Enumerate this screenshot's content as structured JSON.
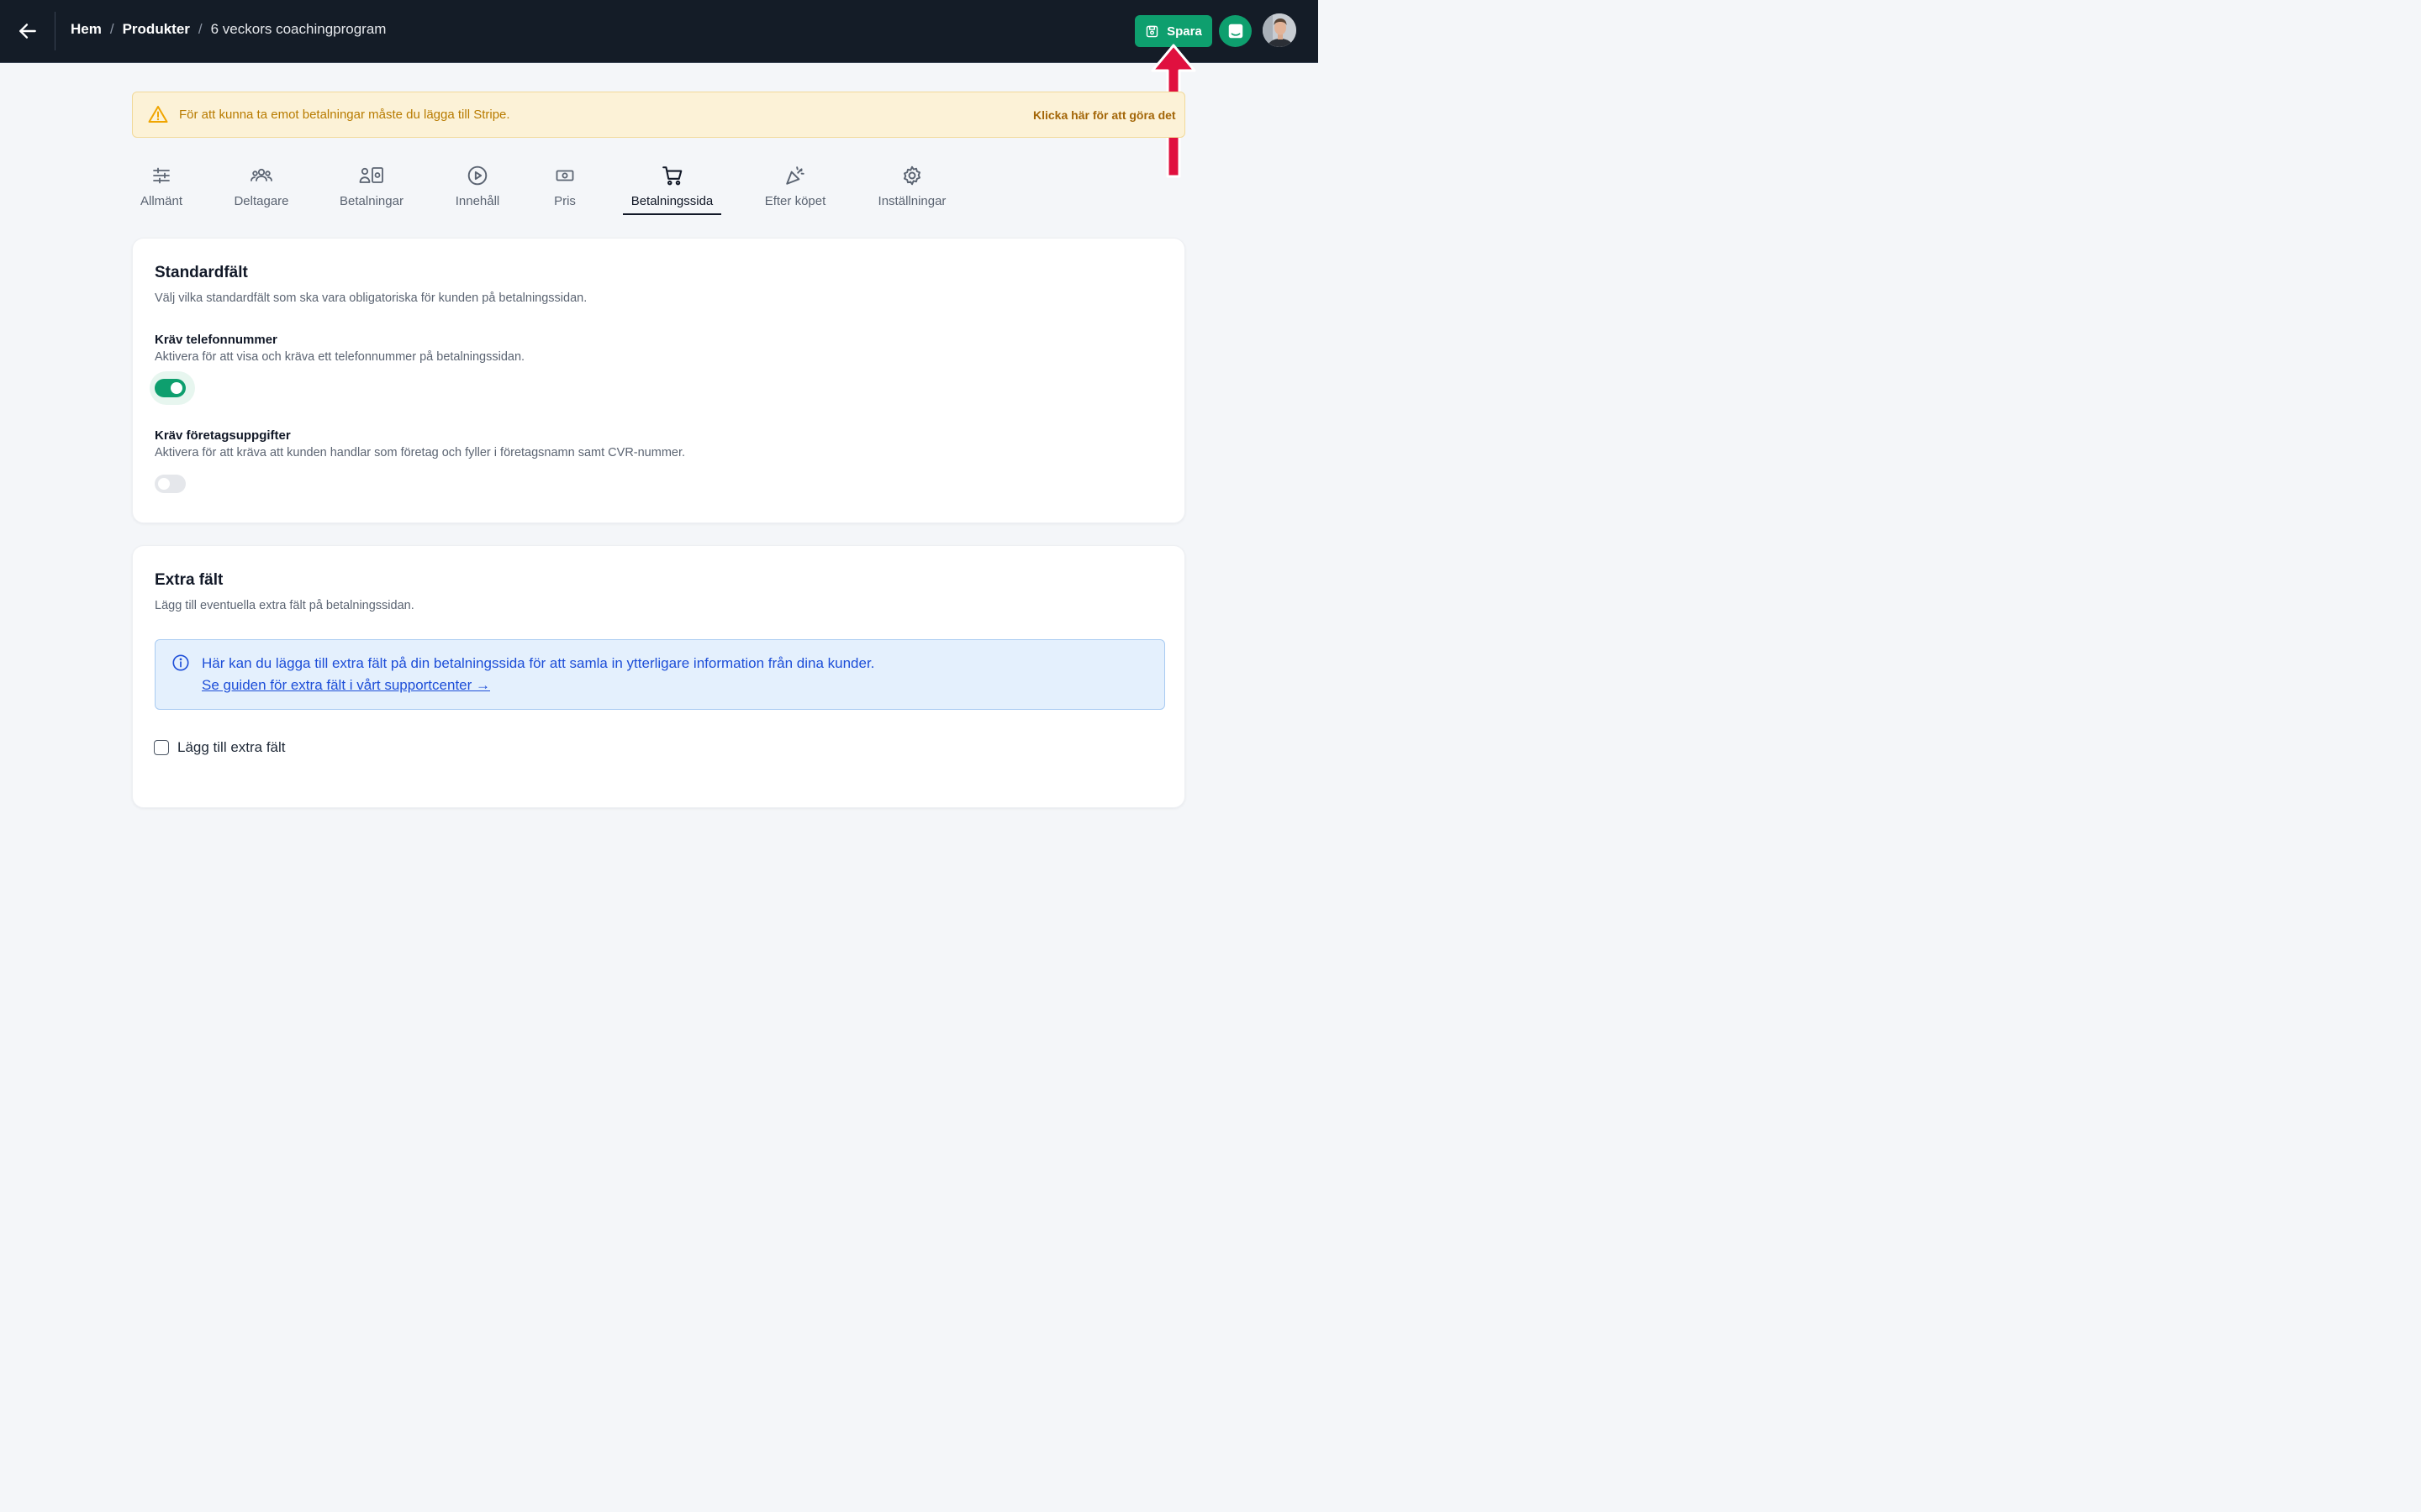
{
  "header": {
    "breadcrumb": {
      "home": "Hem",
      "sep1": "/",
      "products": "Produkter",
      "sep2": "/",
      "current": "6 veckors coachingprogram"
    },
    "save_label": "Spara"
  },
  "alert": {
    "message": "För att kunna ta emot betalningar måste du lägga till Stripe.",
    "action": "Klicka här för att göra det"
  },
  "tabs": [
    {
      "label": "Allmänt",
      "icon": "sliders-icon"
    },
    {
      "label": "Deltagare",
      "icon": "users-icon"
    },
    {
      "label": "Betalningar",
      "icon": "payments-icon"
    },
    {
      "label": "Innehåll",
      "icon": "play-icon"
    },
    {
      "label": "Pris",
      "icon": "banknote-icon"
    },
    {
      "label": "Betalningssida",
      "icon": "cart-icon",
      "active": true
    },
    {
      "label": "Efter köpet",
      "icon": "party-icon"
    },
    {
      "label": "Inställningar",
      "icon": "gear-icon"
    }
  ],
  "standard": {
    "title": "Standardfält",
    "description": "Välj vilka standardfält som ska vara obligatoriska för kunden på betalningssidan.",
    "phone": {
      "label": "Kräv telefonnummer",
      "description": "Aktivera för att visa och kräva ett telefonnummer på betalningssidan.",
      "enabled": true
    },
    "company": {
      "label": "Kräv företagsuppgifter",
      "description": "Aktivera för att kräva att kunden handlar som företag och fyller i företagsnamn samt CVR-nummer.",
      "enabled": false
    }
  },
  "extra": {
    "title": "Extra fält",
    "description": "Lägg till eventuella extra fält på betalningssidan.",
    "info_text": "Här kan du lägga till extra fält på din betalningssida för att samla in ytterligare information från dina kunder.",
    "info_link": "Se guiden för extra fält i vårt supportcenter →",
    "checkbox_label": "Lägg till extra fält",
    "checkbox_checked": false
  },
  "colors": {
    "primary": "#0e9f6e",
    "topbar": "#141c27",
    "annotation_arrow": "#e0103f",
    "warning_bg": "#fcf2d7",
    "info_bg": "#e4f0fd"
  }
}
